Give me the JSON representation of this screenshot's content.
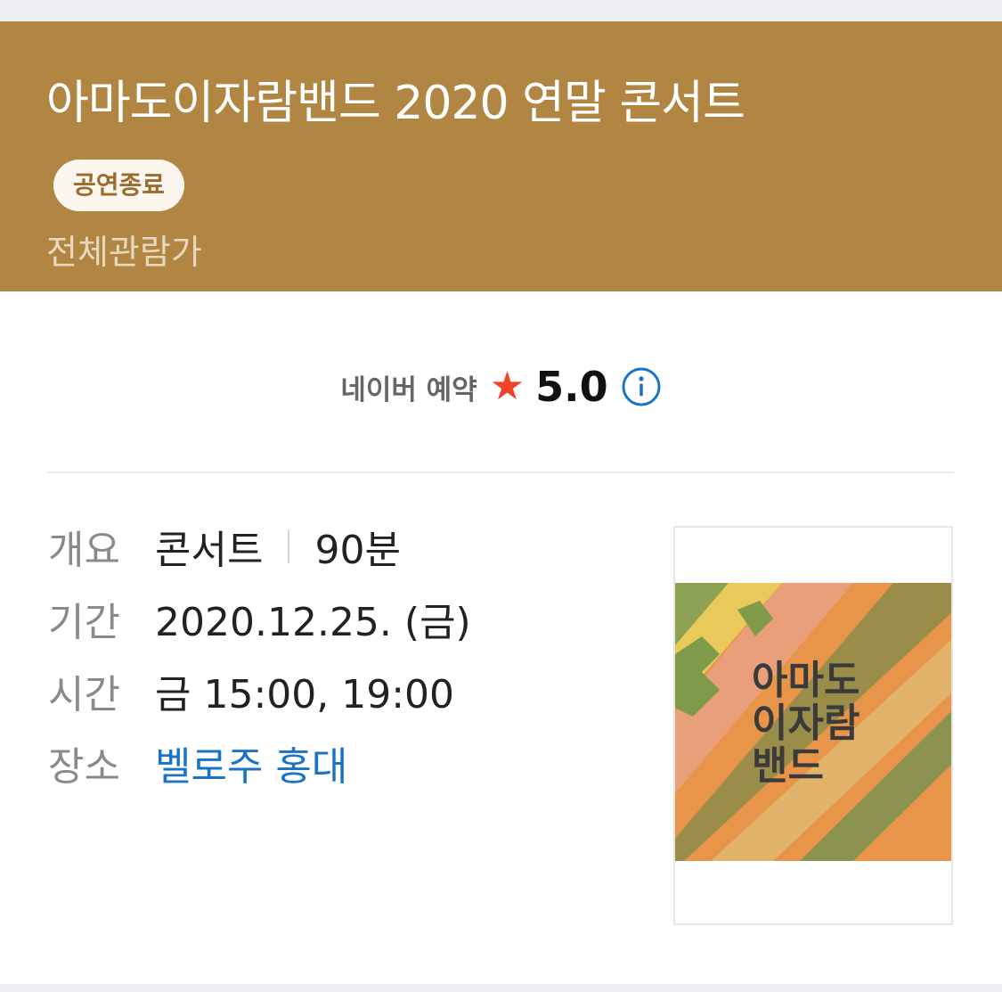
{
  "header": {
    "title": "아마도이자람밴드 2020 연말 콘서트",
    "status_badge": "공연종료",
    "age_rating": "전체관람가"
  },
  "rating": {
    "source_label": "네이버 예약",
    "star_icon": "star-icon",
    "score": "5.0",
    "info_icon": "info-icon"
  },
  "details": {
    "summary": {
      "label": "개요",
      "genre": "콘서트",
      "duration": "90분"
    },
    "period": {
      "label": "기간",
      "value": "2020.12.25. (금)"
    },
    "time": {
      "label": "시간",
      "value": "금 15:00, 19:00"
    },
    "venue": {
      "label": "장소",
      "value": "벨로주 홍대"
    }
  },
  "poster": {
    "title_lines": [
      "아마도",
      "이자람",
      "밴드"
    ]
  },
  "colors": {
    "header_bg": "#b08642",
    "star": "#f0432c",
    "link": "#1a73c7",
    "info": "#1a73c7"
  }
}
